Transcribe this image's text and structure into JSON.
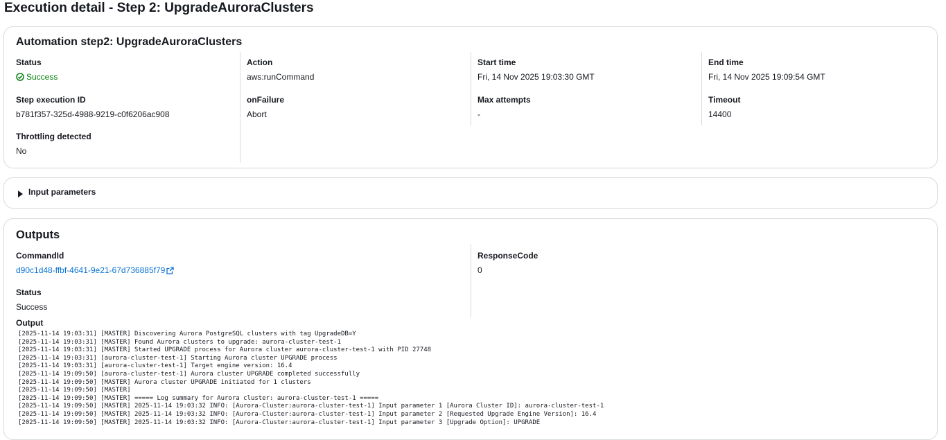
{
  "page": {
    "title": "Execution detail - Step 2: UpgradeAuroraClusters"
  },
  "step_panel": {
    "title": "Automation step2: UpgradeAuroraClusters",
    "status": {
      "label": "Status",
      "value": "Success",
      "icon": "check-circle-icon",
      "color": "#037f0c"
    },
    "step_execution_id": {
      "label": "Step execution ID",
      "value": "b781f357-325d-4988-9219-c0f6206ac908"
    },
    "throttling_detected": {
      "label": "Throttling detected",
      "value": "No"
    },
    "action": {
      "label": "Action",
      "value": "aws:runCommand"
    },
    "on_failure": {
      "label": "onFailure",
      "value": "Abort"
    },
    "start_time": {
      "label": "Start time",
      "value": "Fri, 14 Nov 2025 19:03:30 GMT"
    },
    "max_attempts": {
      "label": "Max attempts",
      "value": "-"
    },
    "end_time": {
      "label": "End time",
      "value": "Fri, 14 Nov 2025 19:09:54 GMT"
    },
    "timeout": {
      "label": "Timeout",
      "value": "14400"
    }
  },
  "input_parameters": {
    "label": "Input parameters",
    "expanded": false
  },
  "outputs": {
    "title": "Outputs",
    "command_id": {
      "label": "CommandId",
      "value": "d90c1d48-ffbf-4641-9e21-67d736885f79",
      "icon": "external-link-icon",
      "color": "#0972d3"
    },
    "response_code": {
      "label": "ResponseCode",
      "value": "0"
    },
    "status": {
      "label": "Status",
      "value": "Success"
    },
    "output_label": "Output",
    "log_lines": [
      "[2025-11-14 19:03:31] [MASTER] Discovering Aurora PostgreSQL clusters with tag UpgradeDB=Y",
      "[2025-11-14 19:03:31] [MASTER] Found Aurora clusters to upgrade: aurora-cluster-test-1",
      "[2025-11-14 19:03:31] [MASTER] Started UPGRADE process for Aurora cluster aurora-cluster-test-1 with PID 27748",
      "[2025-11-14 19:03:31] [aurora-cluster-test-1] Starting Aurora cluster UPGRADE process",
      "[2025-11-14 19:03:31] [aurora-cluster-test-1] Target engine version: 16.4",
      "[2025-11-14 19:09:50] [aurora-cluster-test-1] Aurora cluster UPGRADE completed successfully",
      "[2025-11-14 19:09:50] [MASTER] Aurora cluster UPGRADE initiated for 1 clusters",
      "[2025-11-14 19:09:50] [MASTER]",
      "[2025-11-14 19:09:50] [MASTER] ===== Log summary for Aurora cluster: aurora-cluster-test-1 =====",
      "[2025-11-14 19:09:50] [MASTER] 2025-11-14 19:03:32 INFO: [Aurora-Cluster:aurora-cluster-test-1] Input parameter 1 [Aurora Cluster ID]: aurora-cluster-test-1",
      "[2025-11-14 19:09:50] [MASTER] 2025-11-14 19:03:32 INFO: [Aurora-Cluster:aurora-cluster-test-1] Input parameter 2 [Requested Upgrade Engine Version]: 16.4",
      "[2025-11-14 19:09:50] [MASTER] 2025-11-14 19:03:32 INFO: [Aurora-Cluster:aurora-cluster-test-1] Input parameter 3 [Upgrade Option]: UPGRADE"
    ]
  }
}
